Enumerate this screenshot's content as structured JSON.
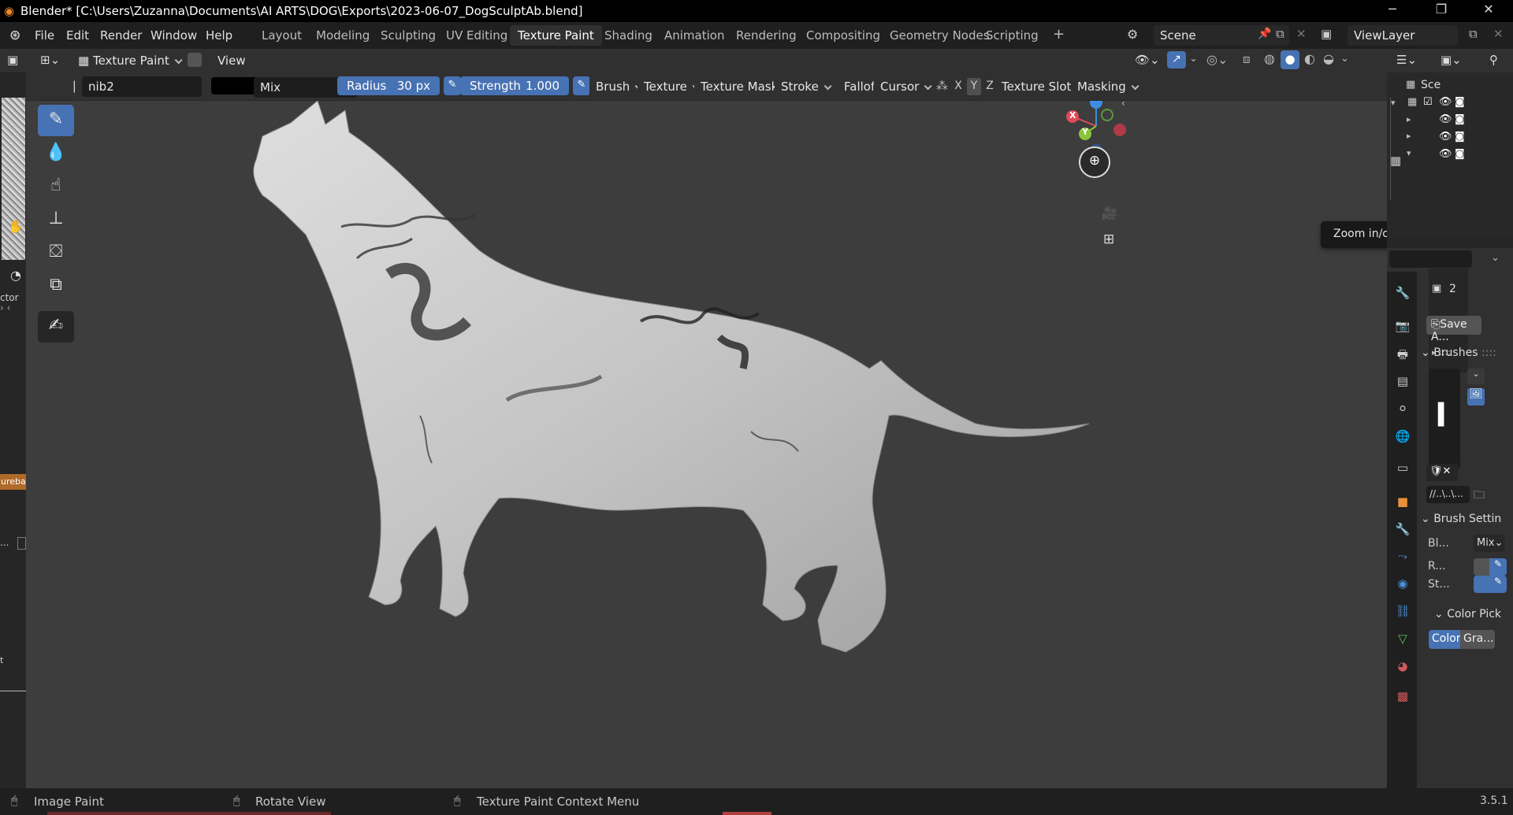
{
  "window": {
    "title": "Blender* [C:\\Users\\Zuzanna\\Documents\\AI ARTS\\DOG\\Exports\\2023-06-07_DogSculptAb.blend]"
  },
  "menu": [
    "File",
    "Edit",
    "Render",
    "Window",
    "Help"
  ],
  "workspaces": [
    "Layout",
    "Modeling",
    "Sculpting",
    "UV Editing",
    "Texture Paint",
    "Shading",
    "Animation",
    "Rendering",
    "Compositing",
    "Geometry Nodes",
    "Scripting"
  ],
  "active_workspace": "Texture Paint",
  "scene": {
    "name": "Scene",
    "view_layer": "ViewLayer"
  },
  "header": {
    "mode": "Texture Paint",
    "view_menu": "View",
    "brush_name": "nib2",
    "blend_mode": "Mix",
    "radius_label": "Radius",
    "radius_value": "30 px",
    "strength_label": "Strength",
    "strength_value": "1.000",
    "menus": [
      "Brush",
      "Texture",
      "Texture Mask",
      "Stroke",
      "Falloff",
      "Cursor"
    ],
    "axes": [
      "X",
      "Y",
      "Z"
    ],
    "texture_slots": "Texture Slots",
    "masking": "Masking"
  },
  "left_panel": {
    "truncated_label_1": "ctor",
    "truncated_label_2": "urebas",
    "truncated_label_3": "...",
    "truncated_label_4": "t"
  },
  "gizmo": {
    "x": "X",
    "y": "Y",
    "z": "Z"
  },
  "tooltip": "Zoom in/out in the view",
  "outliner": {
    "scene_label": "Sce"
  },
  "properties": {
    "image_users": "2",
    "save_button": "Save A...",
    "brushes_header": "Brushes",
    "path_value": "//..\\..\\...",
    "brush_settings_header": "Brush Settin",
    "blend_label": "Bl...",
    "blend_value": "Mix",
    "radius_short": "R...",
    "strength_short": "St...",
    "color_picker_header": "Color Pick",
    "color_tab": "Color",
    "gradient_tab": "Gra..."
  },
  "status": {
    "left": "Image Paint",
    "middle": "Rotate View",
    "right": "Texture Paint Context Menu",
    "version": "3.5.1"
  },
  "colors": {
    "accent": "#4772b3",
    "viewport": "#3d3d3d",
    "header": "#303030",
    "background": "#1d1d1d",
    "axis_x": "#e04a5a",
    "axis_y": "#8bc53f",
    "axis_z": "#3d8ee0"
  }
}
